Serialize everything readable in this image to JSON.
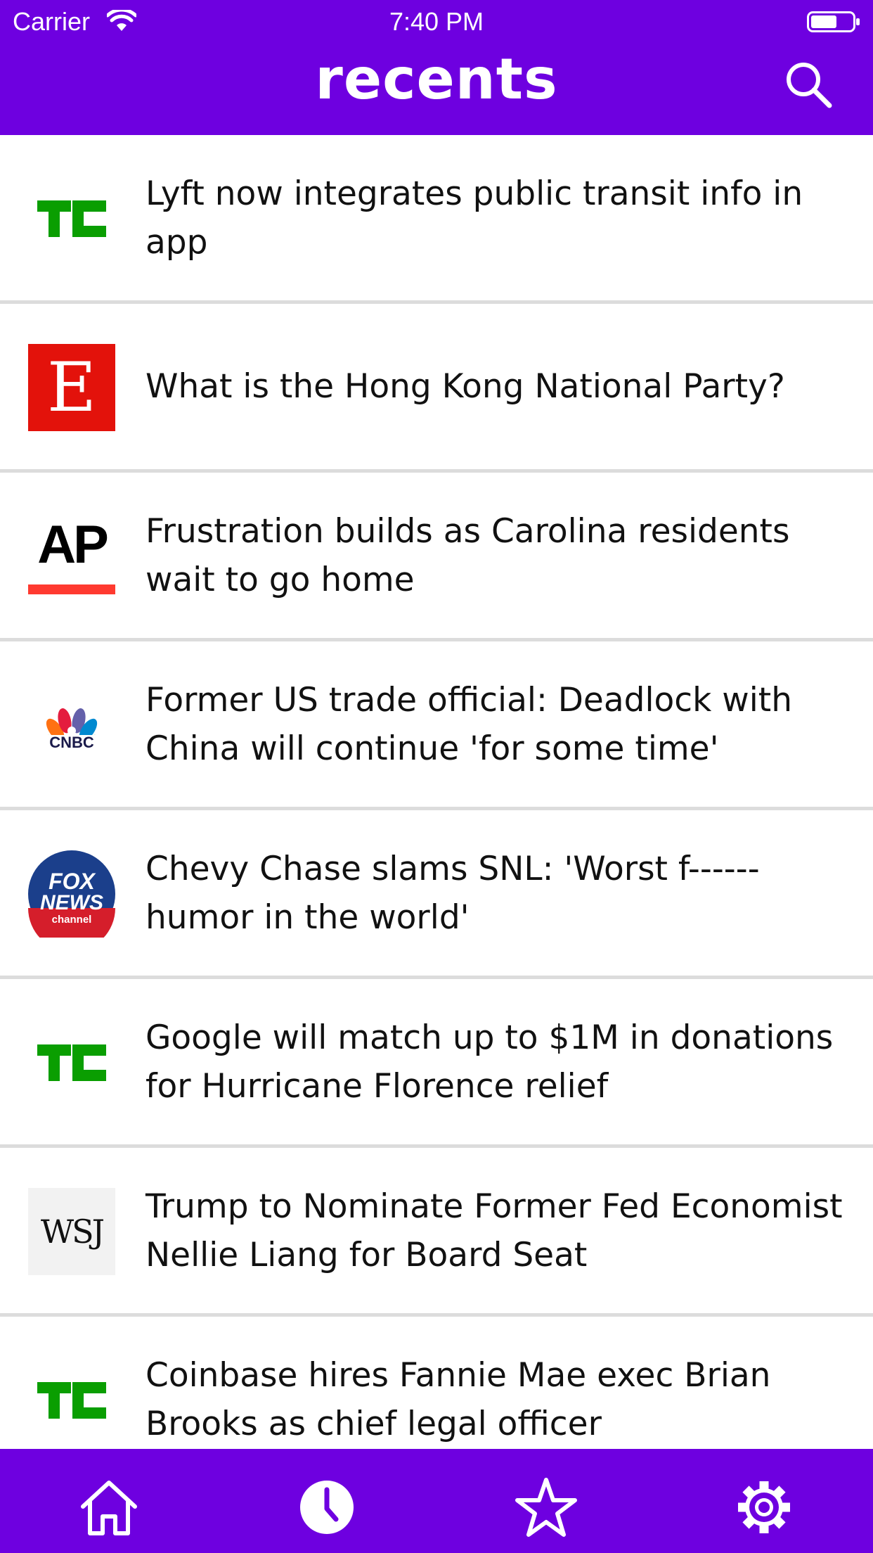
{
  "status": {
    "carrier": "Carrier",
    "time": "7:40 PM"
  },
  "header": {
    "title": "recents"
  },
  "articles": [
    {
      "source": "TC",
      "headline": "Lyft now integrates public transit info in app"
    },
    {
      "source": "E",
      "headline": "What is the Hong Kong National Party?"
    },
    {
      "source": "AP",
      "headline": "Frustration builds as Carolina residents wait to go home"
    },
    {
      "source": "CNBC",
      "headline": "Former US trade official: Deadlock with China will continue 'for some time'"
    },
    {
      "source": "FOX NEWS channel",
      "headline": "Chevy Chase slams SNL: 'Worst f------ humor in the world'"
    },
    {
      "source": "TC",
      "headline": "Google will match up to $1M in donations for Hurricane Florence relief"
    },
    {
      "source": "WSJ",
      "headline": "Trump to Nominate Former Fed Economist Nellie Liang for Board Seat"
    },
    {
      "source": "TC",
      "headline": "Coinbase hires Fannie Mae exec Brian Brooks as chief legal officer"
    }
  ],
  "tabbar": {
    "items": [
      {
        "icon": "home-icon",
        "selected": false
      },
      {
        "icon": "clock-icon",
        "selected": true
      },
      {
        "icon": "star-icon",
        "selected": false
      },
      {
        "icon": "gear-icon",
        "selected": false
      }
    ]
  },
  "colors": {
    "brand": "#6e00e0",
    "tc_green": "#0a9e01",
    "divider": "#dcdcdc"
  }
}
